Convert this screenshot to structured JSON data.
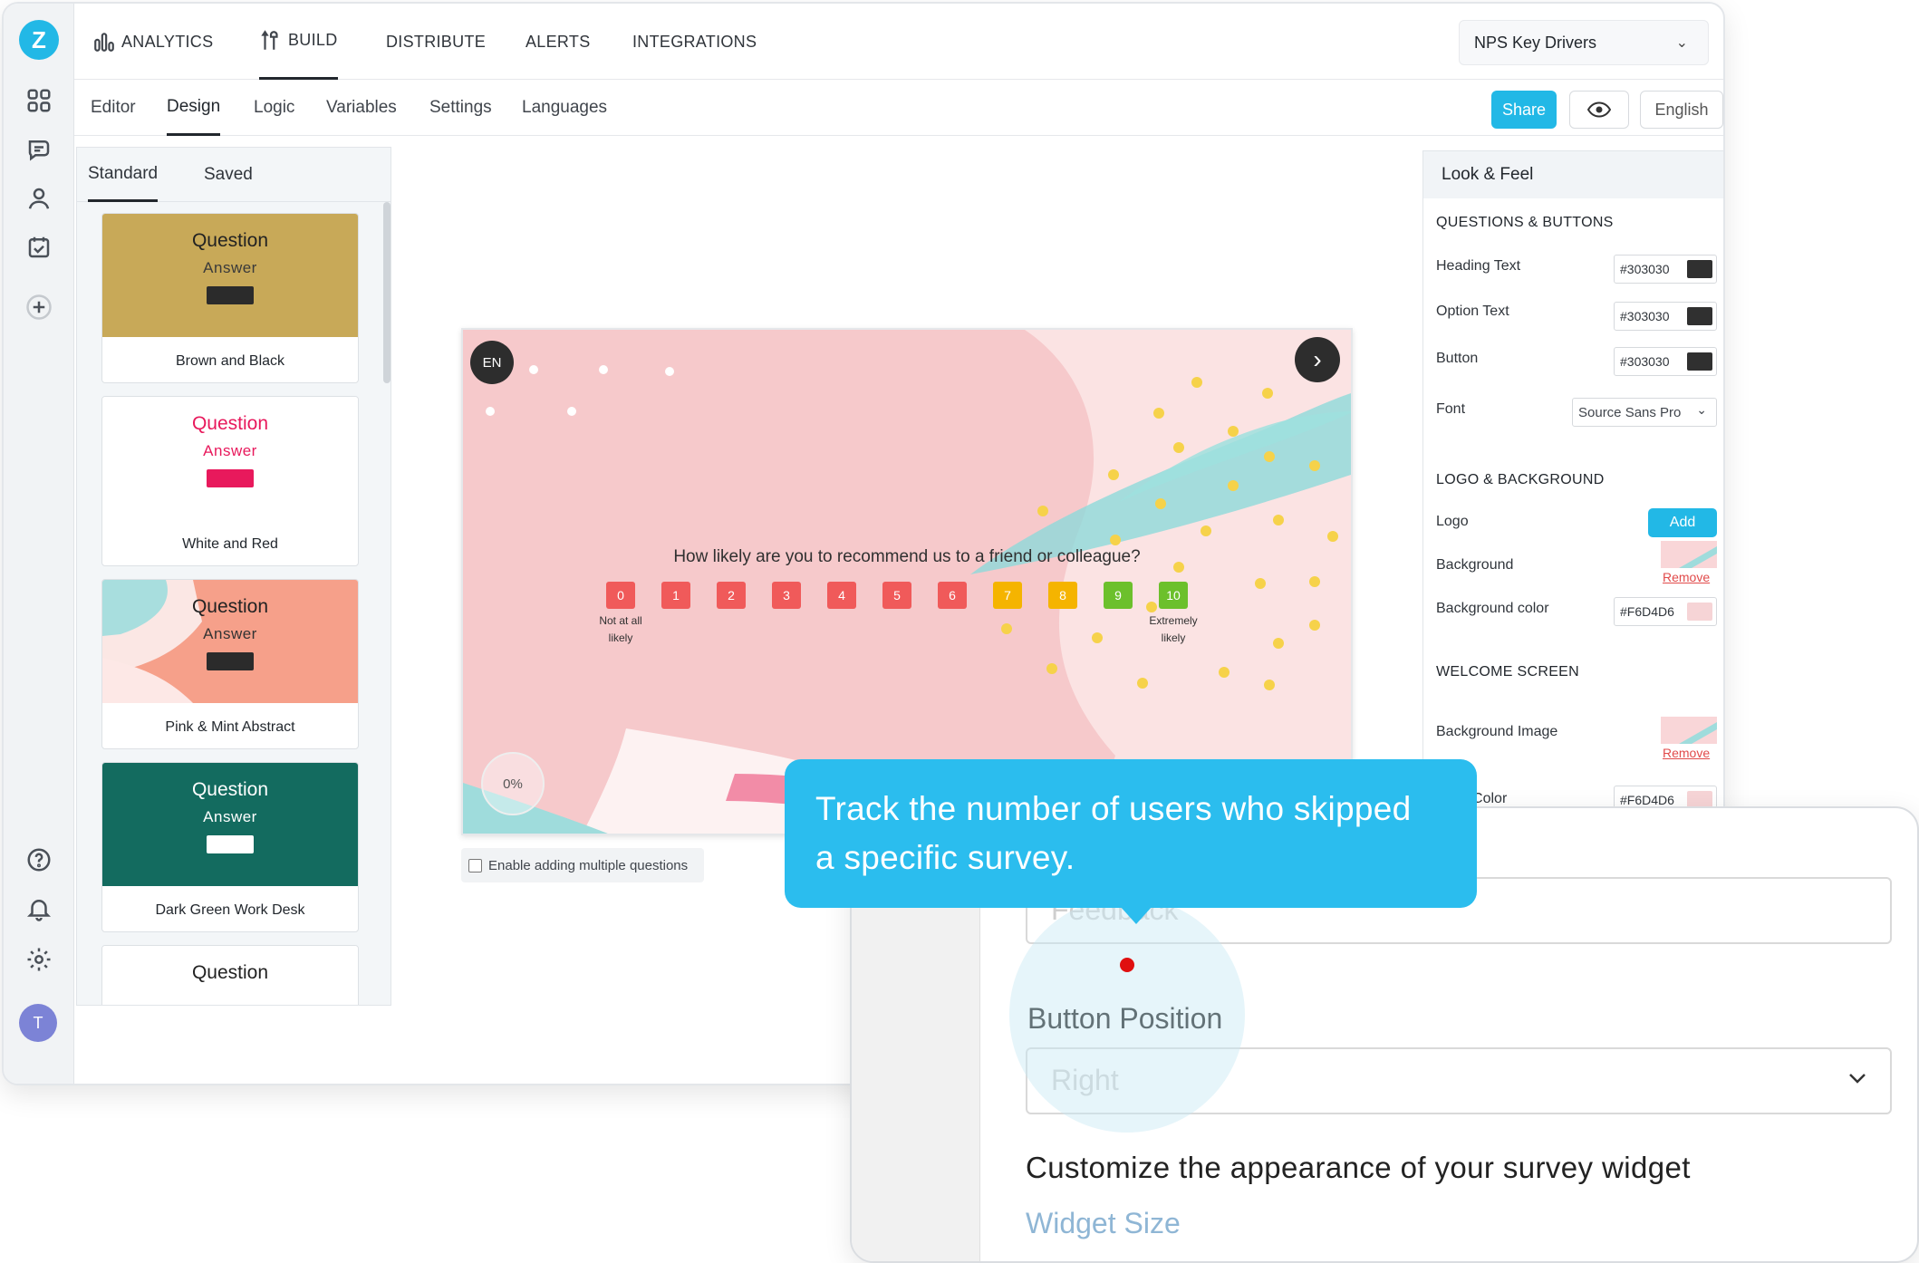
{
  "nav": {
    "analytics": "ANALYTICS",
    "build": "BUILD",
    "distribute": "DISTRIBUTE",
    "alerts": "ALERTS",
    "integrations": "INTEGRATIONS",
    "survey_name": "NPS Key Drivers"
  },
  "subnav": {
    "editor": "Editor",
    "design": "Design",
    "logic": "Logic",
    "variables": "Variables",
    "settings": "Settings",
    "languages": "Languages",
    "share": "Share",
    "language": "English"
  },
  "rail": {
    "logo": "Z",
    "avatar": "T"
  },
  "themes": {
    "tab_standard": "Standard",
    "tab_saved": "Saved",
    "cards": [
      {
        "question": "Question",
        "answer": "Answer",
        "name": "Brown and Black"
      },
      {
        "question": "Question",
        "answer": "Answer",
        "name": "White and Red"
      },
      {
        "question": "Question",
        "answer": "Answer",
        "name": "Pink & Mint Abstract"
      },
      {
        "question": "Question",
        "answer": "Answer",
        "name": "Dark Green Work Desk"
      },
      {
        "question": "Question"
      }
    ]
  },
  "preview": {
    "lang_badge": "EN",
    "question": "How likely are you to recommend us to a friend or colleague?",
    "scale": [
      "0",
      "1",
      "2",
      "3",
      "4",
      "5",
      "6",
      "7",
      "8",
      "9",
      "10"
    ],
    "low_label": "Not at all likely",
    "high_label": "Extremely likely",
    "progress": "0%",
    "multi_label": "Enable adding multiple questions"
  },
  "look_feel": {
    "title": "Look & Feel",
    "sec_questions": "QUESTIONS & BUTTONS",
    "heading_text": "Heading Text",
    "heading_hex": "#303030",
    "option_text": "Option Text",
    "option_hex": "#303030",
    "button": "Button",
    "button_hex": "#303030",
    "font": "Font",
    "font_value": "Source Sans Pro",
    "sec_logo": "LOGO & BACKGROUND",
    "logo": "Logo",
    "add": "Add",
    "background": "Background",
    "remove": "Remove",
    "background_color": "Background color",
    "background_hex": "#F6D4D6",
    "sec_welcome": "WELCOME SCREEN",
    "background_image": "Background Image",
    "remove2": "Remove",
    "welcome_color_label": "ound Color",
    "welcome_hex": "#F6D4D6"
  },
  "zoom": {
    "field1_text": "Feedback",
    "button_position_label": "Button Position",
    "button_position_value": "Right",
    "customize_text": "Customize the appearance of your survey widget",
    "widget_size": "Widget Size"
  },
  "tooltip": {
    "line1": "Track the number of users who skipped",
    "line2": "a specific survey."
  },
  "colors": {
    "accent": "#22b8e6",
    "nps_red": "#f05a5a",
    "nps_yellow": "#f5b400",
    "nps_green": "#6cc02c",
    "bg_pink": "#F6D4D6"
  }
}
